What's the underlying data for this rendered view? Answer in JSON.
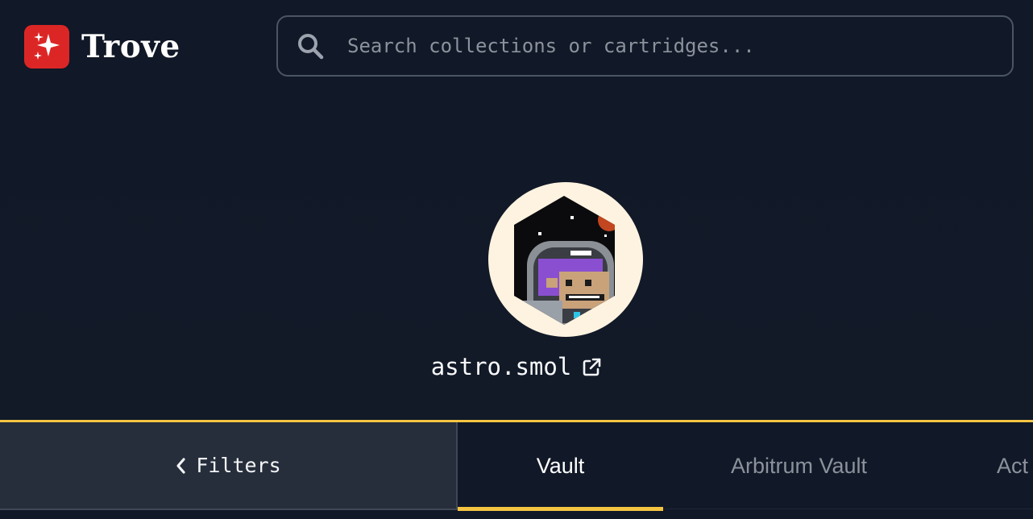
{
  "app": {
    "name": "Trove",
    "brand_color": "#dc2626",
    "accent_color": "#f5c542"
  },
  "header": {
    "logo_icon": "sparkles-icon",
    "search": {
      "placeholder": "Search collections or cartridges...",
      "value": "",
      "icon": "search-icon"
    }
  },
  "profile": {
    "name": "astro.smol",
    "avatar": "astronaut-smol-avatar",
    "external_link_icon": "external-link-icon"
  },
  "filters": {
    "label": "Filters",
    "icon": "chevron-left-icon"
  },
  "tabs": [
    {
      "label": "Vault",
      "active": true
    },
    {
      "label": "Arbitrum Vault",
      "active": false
    },
    {
      "label": "Act",
      "active": false
    }
  ]
}
